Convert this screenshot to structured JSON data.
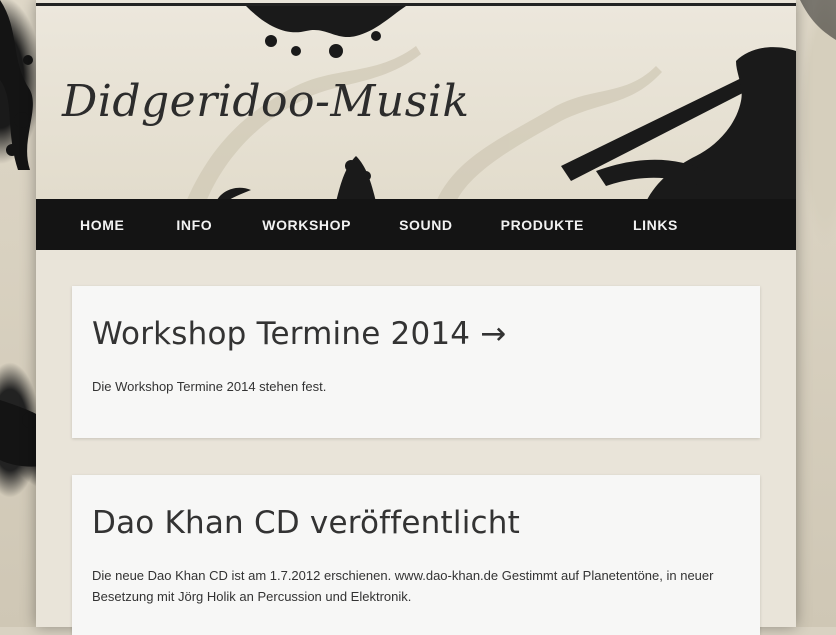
{
  "site": {
    "title": "Didgeridoo-Musik"
  },
  "nav": {
    "items": [
      {
        "label": "HOME"
      },
      {
        "label": "INFO"
      },
      {
        "label": "WORKSHOP"
      },
      {
        "label": "SOUND"
      },
      {
        "label": "PRODUKTE"
      },
      {
        "label": "LINKS"
      }
    ]
  },
  "posts": [
    {
      "title": "Workshop Termine 2014 →",
      "excerpt": "Die Workshop Termine 2014 stehen fest."
    },
    {
      "title": "Dao Khan CD veröffentlicht",
      "excerpt": "Die neue Dao Khan CD ist am 1.7.2012 erschienen. www.dao-khan.de Gestimmt auf Planetentöne, in neuer Besetzung mit Jörg Holik an Percussion und Elektronik."
    }
  ],
  "colors": {
    "nav_bg": "#141414",
    "post_bg": "#f7f7f6",
    "text": "#333333"
  }
}
